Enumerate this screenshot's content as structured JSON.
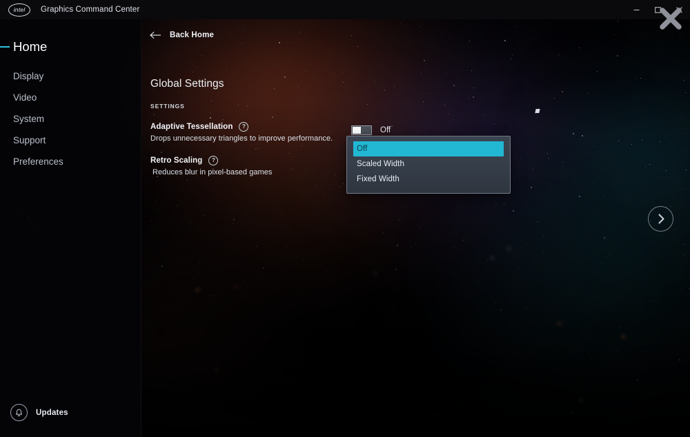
{
  "window": {
    "logo_text": "intel",
    "logo_icon": "intel-logo",
    "title": "Graphics Command Center",
    "controls": {
      "minimize": "minimize-icon",
      "maximize": "maximize-icon",
      "close": "close-icon"
    }
  },
  "sidebar": {
    "items": [
      {
        "label": "Home",
        "active": true
      },
      {
        "label": "Display",
        "active": false
      },
      {
        "label": "Video",
        "active": false
      },
      {
        "label": "System",
        "active": false
      },
      {
        "label": "Support",
        "active": false
      },
      {
        "label": "Preferences",
        "active": false
      }
    ],
    "updates": {
      "label": "Updates",
      "icon": "bell-icon"
    }
  },
  "main": {
    "back": {
      "label": "Back Home",
      "icon": "arrow-left-icon"
    },
    "page_title": "Global Settings",
    "section_label": "SETTINGS",
    "settings": [
      {
        "name": "Adaptive Tessellation",
        "description": "Drops unnecessary triangles to improve performance.",
        "help_icon": "question-circle-icon",
        "control": "toggle",
        "state": "Off"
      },
      {
        "name": "Retro Scaling",
        "description": "Reduces blur in pixel-based games",
        "help_icon": "question-circle-icon",
        "control": "dropdown",
        "state": "Off"
      }
    ]
  },
  "dropdown": {
    "open": true,
    "selected": "Off",
    "options": [
      {
        "label": "Off",
        "selected": true
      },
      {
        "label": "Scaled Width",
        "selected": false
      },
      {
        "label": "Fixed Width",
        "selected": false
      }
    ]
  },
  "carousel": {
    "prev_icon": "chevron-left-icon",
    "next_icon": "chevron-right-icon"
  },
  "colors": {
    "accent": "#2ec3e0",
    "dropdown_highlight": "#22b8d4",
    "titlebar_bg": "#0a0a0c",
    "sidebar_bg": "#040407",
    "text_primary": "#f0f3f8",
    "text_secondary": "#b9bfca"
  }
}
